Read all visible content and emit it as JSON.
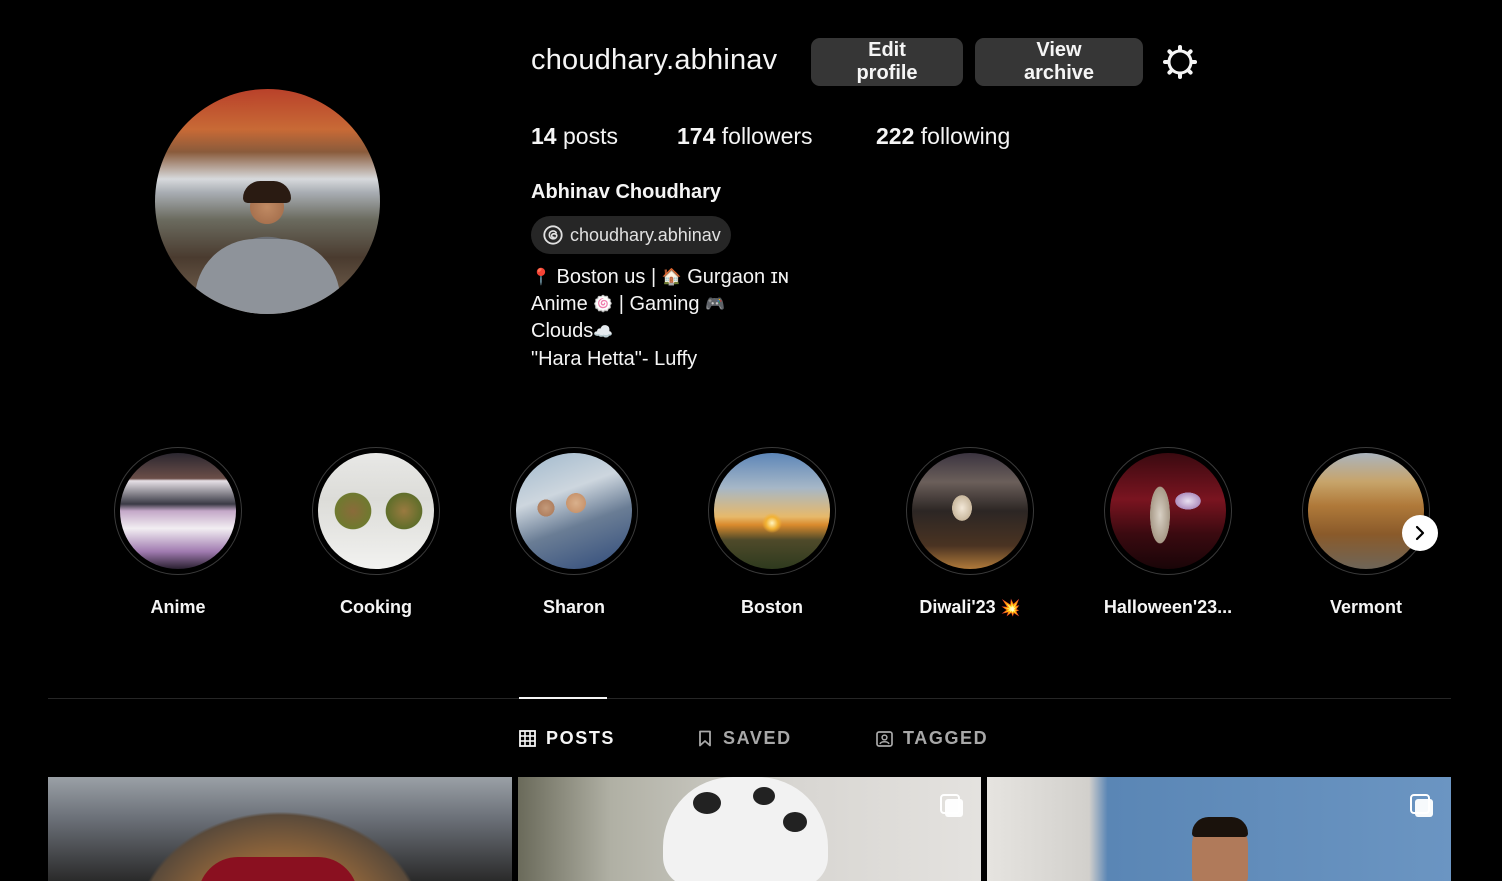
{
  "profile": {
    "username": "choudhary.abhinav",
    "edit_label": "Edit profile",
    "archive_label": "View archive",
    "stats": {
      "posts_count": "14",
      "posts_label": "posts",
      "followers_count": "174",
      "followers_label": "followers",
      "following_count": "222",
      "following_label": "following"
    },
    "full_name": "Abhinav Choudhary",
    "threads_handle": "choudhary.abhinav",
    "bio": {
      "line1_a": "📍",
      "line1_b": "Boston us | ",
      "line1_c": "🏠",
      "line1_d": " Gurgaon ɪɴ",
      "line2_a": "Anime ",
      "line2_b": "🍥",
      "line2_c": " | Gaming ",
      "line2_d": "🎮",
      "line3_a": "Clouds",
      "line3_b": "☁️",
      "line4": "\"Hara Hetta\"- Luffy"
    }
  },
  "highlights": [
    {
      "label": "Anime",
      "emoji": ""
    },
    {
      "label": "Cooking",
      "emoji": ""
    },
    {
      "label": "Sharon",
      "emoji": ""
    },
    {
      "label": "Boston",
      "emoji": ""
    },
    {
      "label": "Diwali'23",
      "emoji": "💥"
    },
    {
      "label": "Halloween'23...",
      "emoji": ""
    },
    {
      "label": "Vermont",
      "emoji": ""
    }
  ],
  "tabs": {
    "posts": "POSTS",
    "saved": "SAVED",
    "tagged": "TAGGED"
  },
  "colors": {
    "background": "#000000",
    "button": "#363636",
    "text": "#f5f5f5",
    "muted": "#a8a8a8"
  },
  "icons": [
    "gear-icon",
    "threads-icon",
    "chevron-right-icon",
    "grid-icon",
    "bookmark-icon",
    "tag-icon",
    "multiple-posts-icon"
  ]
}
